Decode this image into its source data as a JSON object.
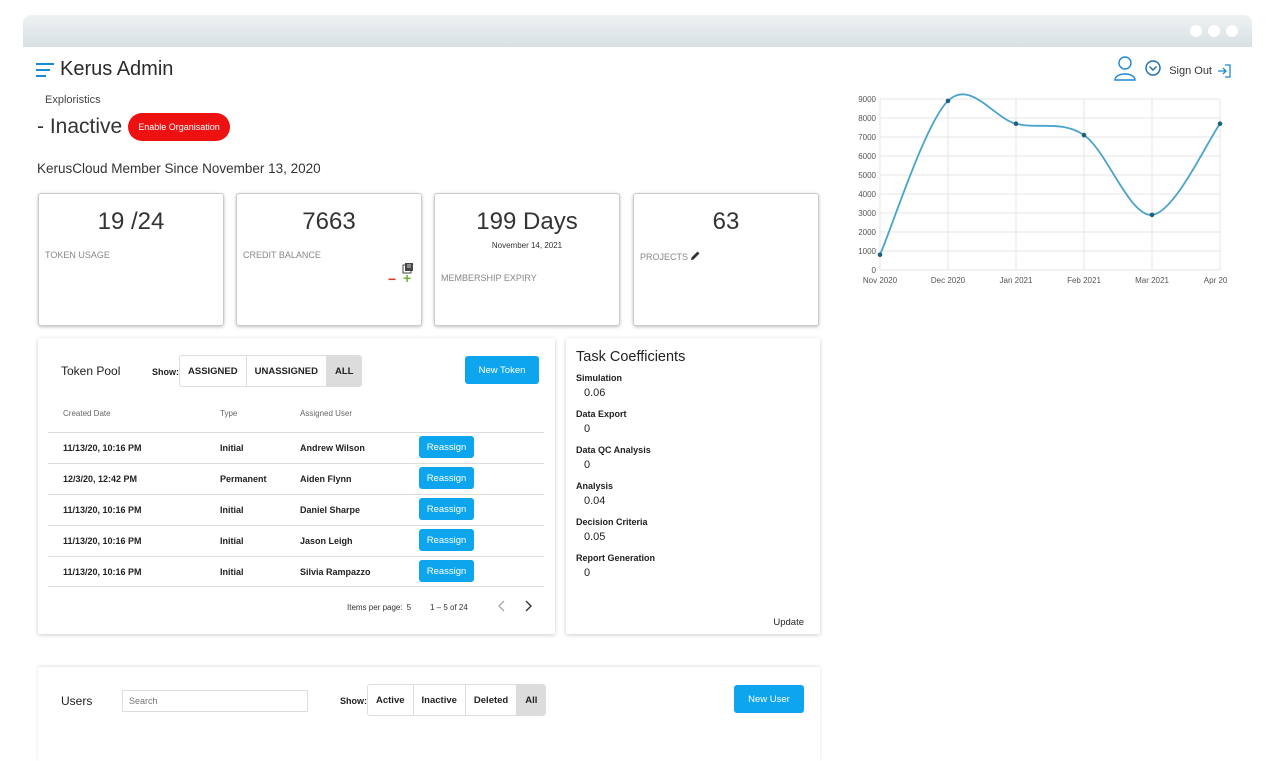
{
  "header": {
    "app_title": "Kerus Admin",
    "sign_out_label": "Sign Out"
  },
  "org": {
    "name": "Exploristics",
    "status": "- Inactive",
    "enable_label": "Enable Organisation",
    "member_since": "KerusCloud Member Since November 13, 2020"
  },
  "stats": {
    "tokens": {
      "value": "19 /24",
      "label": "TOKEN USAGE"
    },
    "credits": {
      "value": "7663",
      "label": "CREDIT BALANCE",
      "minus": "−",
      "plus": "+"
    },
    "membership": {
      "value": "199 Days",
      "date": "November 14, 2021",
      "label": "MEMBERSHIP EXPIRY"
    },
    "projects": {
      "value": "63",
      "label": "PROJECTS"
    }
  },
  "token_pool": {
    "title": "Token Pool",
    "show_label": "Show:",
    "filters": [
      "ASSIGNED",
      "UNASSIGNED",
      "ALL"
    ],
    "active_filter": "ALL",
    "new_label": "New Token",
    "columns": [
      "Created Date",
      "Type",
      "Assigned User"
    ],
    "rows": [
      {
        "date": "11/13/20, 10:16 PM",
        "type": "Initial",
        "user": "Andrew Wilson",
        "action": "Reassign"
      },
      {
        "date": "12/3/20, 12:42 PM",
        "type": "Permanent",
        "user": "Aiden Flynn",
        "action": "Reassign"
      },
      {
        "date": "11/13/20, 10:16 PM",
        "type": "Initial",
        "user": "Daniel Sharpe",
        "action": "Reassign"
      },
      {
        "date": "11/13/20, 10:16 PM",
        "type": "Initial",
        "user": "Jason Leigh",
        "action": "Reassign"
      },
      {
        "date": "11/13/20, 10:16 PM",
        "type": "Initial",
        "user": "Silvia Rampazzo",
        "action": "Reassign"
      }
    ],
    "items_per_page_label": "Items per page:",
    "items_per_page": "5",
    "range": "1 – 5 of 24"
  },
  "coefficients": {
    "title": "Task Coefficients",
    "items": [
      {
        "name": "Simulation",
        "value": "0.06"
      },
      {
        "name": "Data Export",
        "value": "0"
      },
      {
        "name": "Data QC Analysis",
        "value": "0"
      },
      {
        "name": "Analysis",
        "value": "0.04"
      },
      {
        "name": "Decision Criteria",
        "value": "0.05"
      },
      {
        "name": "Report Generation",
        "value": "0"
      }
    ],
    "update_label": "Update"
  },
  "users": {
    "title": "Users",
    "search_placeholder": "Search",
    "show_label": "Show:",
    "filters": [
      "Active",
      "Inactive",
      "Deleted",
      "All"
    ],
    "active_filter": "All",
    "new_label": "New User"
  },
  "chart_data": {
    "type": "line",
    "categories": [
      "Nov 2020",
      "Dec 2020",
      "Jan 2021",
      "Feb 2021",
      "Mar 2021",
      "Apr 2021"
    ],
    "values": [
      800,
      8900,
      7700,
      7100,
      2900,
      7700
    ],
    "ylim": [
      0,
      9000
    ],
    "yticks": [
      0,
      1000,
      2000,
      3000,
      4000,
      5000,
      6000,
      7000,
      8000,
      9000
    ],
    "grid": true,
    "color": "#4aa3cc"
  },
  "colors": {
    "accent": "#0ea5ef",
    "danger": "#ee1111"
  }
}
